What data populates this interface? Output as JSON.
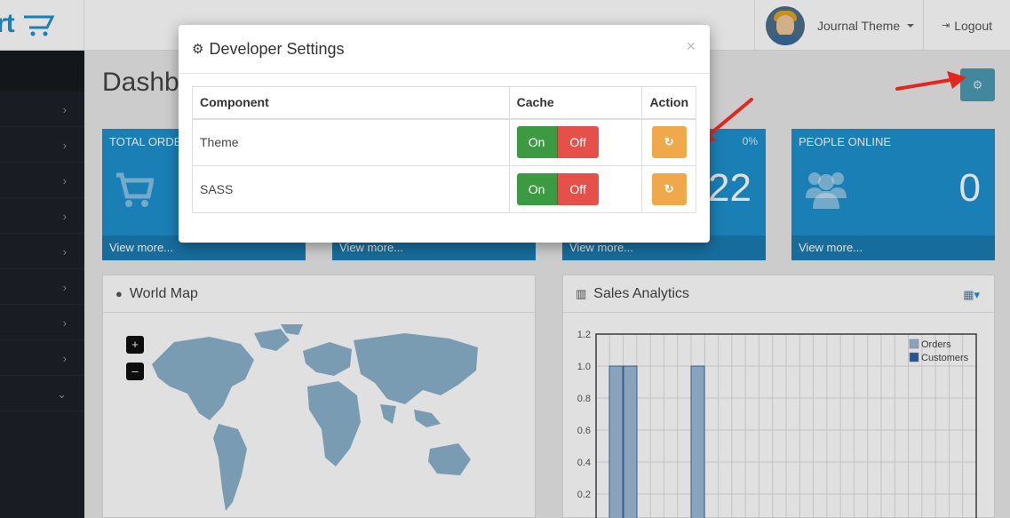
{
  "header": {
    "logo_text": "rt",
    "user_name": "Journal Theme",
    "logout_label": "Logout"
  },
  "page": {
    "title": "Dashb"
  },
  "tiles": [
    {
      "title": "TOTAL ORDE",
      "pct": "",
      "value": "",
      "foot": "View more..."
    },
    {
      "title": "",
      "pct": "",
      "value": "",
      "foot": "View more..."
    },
    {
      "title": "",
      "pct": "0%",
      "value": "22",
      "foot": "View more..."
    },
    {
      "title": "PEOPLE ONLINE",
      "pct": "",
      "value": "0",
      "foot": "View more..."
    }
  ],
  "panels": {
    "world_map": {
      "title": "World Map",
      "zoom_in": "+",
      "zoom_out": "–"
    },
    "sales": {
      "title": "Sales Analytics"
    }
  },
  "chart_data": {
    "type": "bar",
    "title": "",
    "ylim": [
      0,
      1.2
    ],
    "y_ticks": [
      "1.2",
      "1.0",
      "0.8",
      "0.6",
      "0.4",
      "0.2"
    ],
    "legend": "top-right",
    "grid": true,
    "series": [
      {
        "name": "Orders",
        "color": "#9fb9d6",
        "values": [
          1,
          1,
          1
        ]
      },
      {
        "name": "Customers",
        "color": "#2c5fa8",
        "values": []
      }
    ]
  },
  "modal": {
    "title": "Developer Settings",
    "close": "×",
    "headers": {
      "component": "Component",
      "cache": "Cache",
      "action": "Action"
    },
    "rows": [
      {
        "component": "Theme",
        "on": "On",
        "off": "Off"
      },
      {
        "component": "SASS",
        "on": "On",
        "off": "Off"
      }
    ]
  },
  "colors": {
    "primary": "#1e91cf",
    "on": "#3c9a42",
    "off": "#e5504a",
    "action": "#f0a94a",
    "arrow": "#e3261e"
  }
}
